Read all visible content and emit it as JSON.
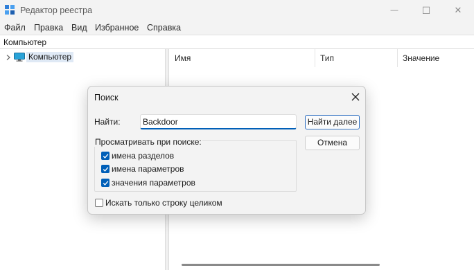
{
  "window": {
    "title": "Редактор реестра",
    "minimize_glyph": "—",
    "maximize_glyph": "☐",
    "close_glyph": "✕"
  },
  "menu": {
    "items": [
      "Файл",
      "Правка",
      "Вид",
      "Избранное",
      "Справка"
    ]
  },
  "address": {
    "path": "Компьютер"
  },
  "tree": {
    "root_label": "Компьютер",
    "root_icon": "computer-icon"
  },
  "list": {
    "columns": [
      "Имя",
      "Тип",
      "Значение"
    ]
  },
  "find_dialog": {
    "title": "Поиск",
    "find_label": "Найти:",
    "find_value": "Backdoor",
    "find_next_label": "Найти далее",
    "cancel_label": "Отмена",
    "look_at_label": "Просматривать при поиске:",
    "options": [
      {
        "label": "имена разделов",
        "checked": true
      },
      {
        "label": "имена параметров",
        "checked": true
      },
      {
        "label": "значения параметров",
        "checked": true
      }
    ],
    "whole_string_label": "Искать только строку целиком",
    "whole_string_checked": false
  },
  "colors": {
    "accent": "#005fb8",
    "selection": "#dfe9f5"
  }
}
